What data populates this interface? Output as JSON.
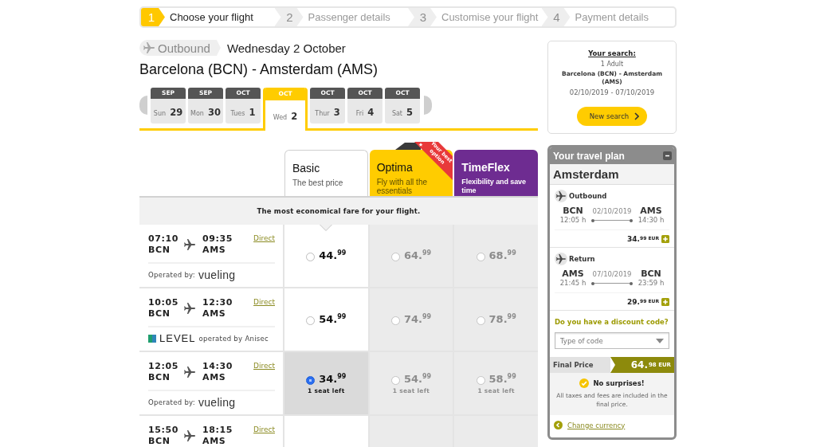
{
  "steps": [
    {
      "number": "1",
      "label": "Choose your flight",
      "selected": true
    },
    {
      "number": "2",
      "label": "Passenger details",
      "selected": false
    },
    {
      "number": "3",
      "label": "Customise your flight",
      "selected": false
    },
    {
      "number": "4",
      "label": "Payment details",
      "selected": false
    }
  ],
  "flight_header": {
    "direction": "Outbound",
    "date": "Wednesday 2 October",
    "route": "Barcelona (BCN) - Amsterdam (AMS)"
  },
  "date_tabs": [
    {
      "month": "SEP",
      "weekday": "Sun",
      "day": "29",
      "selected": false
    },
    {
      "month": "SEP",
      "weekday": "Mon",
      "day": "30",
      "selected": false
    },
    {
      "month": "OCT",
      "weekday": "Tues",
      "day": "1",
      "selected": false
    },
    {
      "month": "OCT",
      "weekday": "Wed",
      "day": "2",
      "selected": true
    },
    {
      "month": "OCT",
      "weekday": "Thur",
      "day": "3",
      "selected": false
    },
    {
      "month": "OCT",
      "weekday": "Fri",
      "day": "4",
      "selected": false
    },
    {
      "month": "OCT",
      "weekday": "Sat",
      "day": "5",
      "selected": false
    }
  ],
  "fares": [
    {
      "kind": "basic",
      "name": "Basic",
      "tagline": "The best price",
      "selected": true
    },
    {
      "kind": "optima",
      "name": "Optima",
      "tagline": "Fly with all the essentials",
      "ribbon": "Your best option",
      "selected": false
    },
    {
      "kind": "timeflex",
      "name": "TimeFlex",
      "tagline": "Flexibility and save time",
      "selected": false
    }
  ],
  "fare_banner": "The most economical fare for your flight.",
  "flights": [
    {
      "depart_time": "07:10",
      "depart_code": "BCN",
      "arrive_time": "09:35",
      "arrive_code": "AMS",
      "stops": "Direct",
      "operator": {
        "kind": "vueling",
        "label": "Operated by:",
        "brand": "vueling"
      },
      "prices": [
        {
          "price": "44.$^{99}$",
          "selected": false
        },
        {
          "price": "64.$^{99}$",
          "selected": false
        },
        {
          "price": "68.$^{99}$",
          "selected": false
        }
      ]
    },
    {
      "depart_time": "10:05",
      "depart_code": "BCN",
      "arrive_time": "12:30",
      "arrive_code": "AMS",
      "stops": "Direct",
      "operator": {
        "kind": "level",
        "label": "operated by Anisec",
        "brand": "LEVEL"
      },
      "prices": [
        {
          "price": "54.$^{99}$",
          "selected": false
        },
        {
          "price": "74.$^{99}$",
          "selected": false
        },
        {
          "price": "78.$^{99}$",
          "selected": false
        }
      ]
    },
    {
      "depart_time": "12:05",
      "depart_code": "BCN",
      "arrive_time": "14:30",
      "arrive_code": "AMS",
      "stops": "Direct",
      "operator": {
        "kind": "vueling",
        "label": "Operated by:",
        "brand": "vueling"
      },
      "prices": [
        {
          "price": "34.$^{99}$",
          "note": "1 seat left",
          "selected": true
        },
        {
          "price": "54.$^{99}$",
          "note": "1 seat left",
          "selected": false
        },
        {
          "price": "58.$^{99}$",
          "note": "1 seat left",
          "selected": false
        }
      ]
    },
    {
      "depart_time": "15:50",
      "depart_code": "BCN",
      "arrive_time": "18:15",
      "arrive_code": "AMS",
      "stops": "Direct"
    }
  ],
  "search_summary": {
    "title": "Your search:",
    "passengers": "1 Adult",
    "route": "Barcelona (BCN) - Amsterdam (AMS)",
    "dates": "02/10/2019 - 07/10/2019",
    "button": "New search"
  },
  "travel_plan": {
    "title": "Your travel plan",
    "expanded": true,
    "destination": "Amsterdam",
    "legs": [
      {
        "label": "Outbound",
        "from_code": "BCN",
        "from_time": "12:05 h",
        "date": "02/10/2019",
        "to_code": "AMS",
        "to_time": "14:30 h",
        "price": "34.$^{99 EUR}$"
      },
      {
        "label": "Return",
        "from_code": "AMS",
        "from_time": "21:45 h",
        "date": "07/10/2019",
        "to_code": "BCN",
        "to_time": "23:59 h",
        "price": "29.$^{99 EUR}$"
      }
    ],
    "discount": {
      "question": "Do you have a discount code?",
      "placeholder": "Type of code"
    },
    "final_price": {
      "label": "Final Price",
      "amount": "64.$^{98 EUR}$"
    },
    "guarantee": {
      "title": "No surprises!",
      "text": "All taxes and fees are included in the final price."
    },
    "currency_link": "Change currency"
  }
}
